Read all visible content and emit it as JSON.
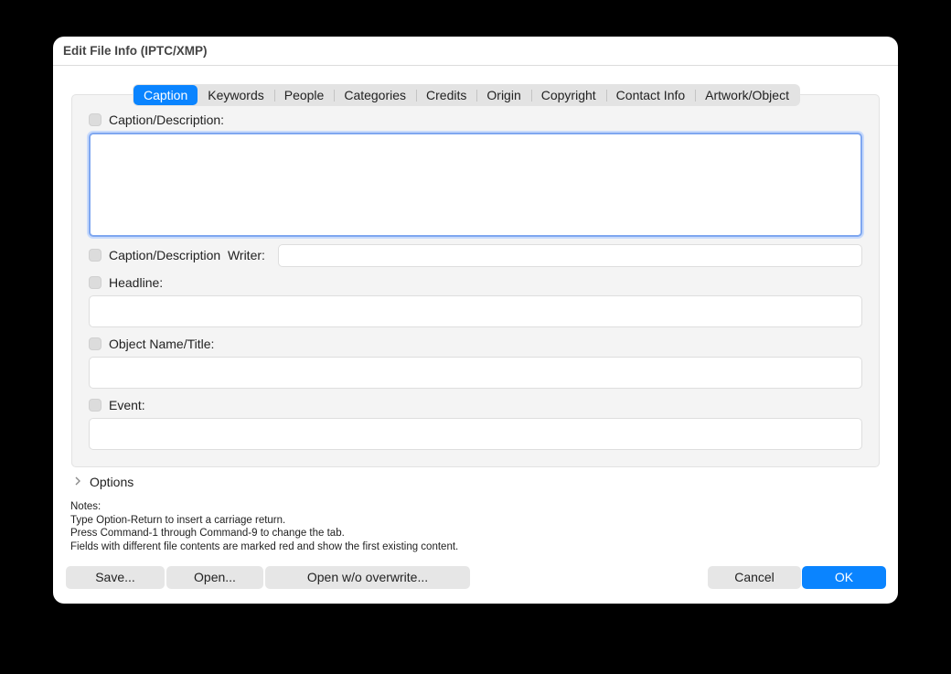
{
  "window": {
    "title": "Edit File Info (IPTC/XMP)"
  },
  "tabs": [
    {
      "label": "Caption",
      "active": true
    },
    {
      "label": "Keywords"
    },
    {
      "label": "People"
    },
    {
      "label": "Categories"
    },
    {
      "label": "Credits"
    },
    {
      "label": "Origin"
    },
    {
      "label": "Copyright"
    },
    {
      "label": "Contact Info"
    },
    {
      "label": "Artwork/Object"
    }
  ],
  "fields": {
    "caption": {
      "label": "Caption/Description:",
      "value": ""
    },
    "writer": {
      "label": "Caption/Description  Writer:",
      "value": ""
    },
    "headline": {
      "label": "Headline:",
      "value": ""
    },
    "object_name": {
      "label": "Object Name/Title:",
      "value": ""
    },
    "event": {
      "label": "Event:",
      "value": ""
    }
  },
  "options": {
    "label": "Options"
  },
  "notes": {
    "heading": "Notes:",
    "lines": [
      "Type Option-Return to insert a carriage return.",
      "Press Command-1 through Command-9 to change the tab.",
      "Fields with different file contents are marked red and show the first existing content."
    ]
  },
  "buttons": {
    "save": "Save...",
    "open": "Open...",
    "open_no_overwrite": "Open w/o overwrite...",
    "cancel": "Cancel",
    "ok": "OK"
  },
  "colors": {
    "accent": "#0a84ff",
    "focus_ring": "#7fa7f0"
  }
}
